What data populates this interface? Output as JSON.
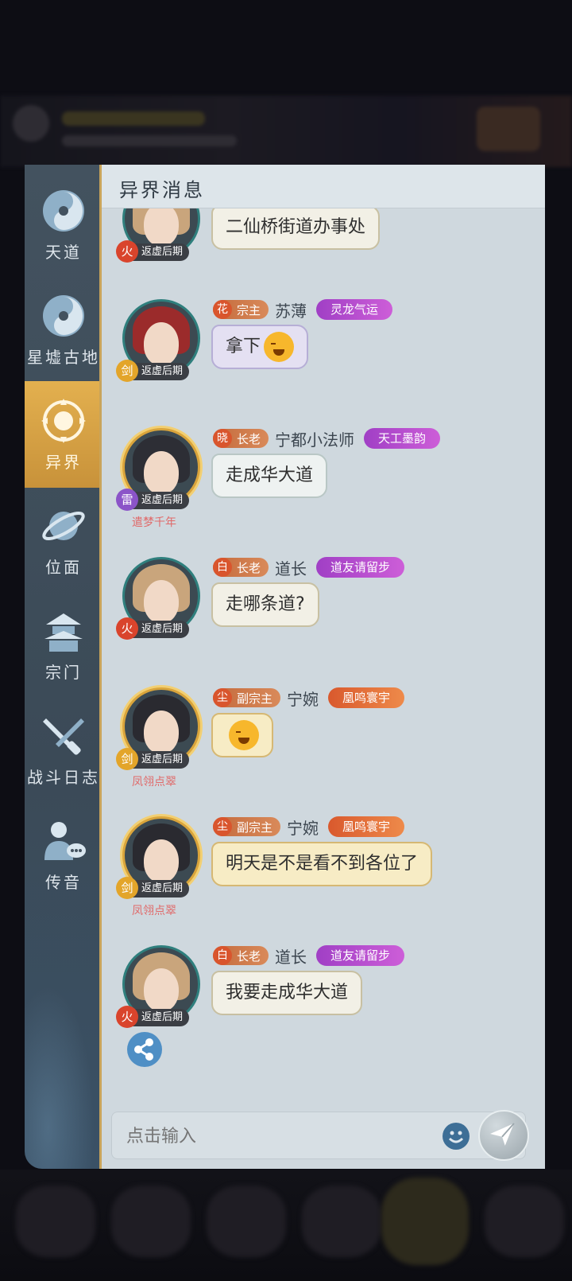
{
  "sidebar": {
    "items": [
      {
        "label": "天道",
        "icon": "taiji-swirl-icon",
        "active": false
      },
      {
        "label": "星墟古地",
        "icon": "taiji-swirl-icon",
        "active": false
      },
      {
        "label": "异界",
        "icon": "lotus-emblem-icon",
        "active": true
      },
      {
        "label": "位面",
        "icon": "planet-icon",
        "active": false
      },
      {
        "label": "宗门",
        "icon": "pagoda-icon",
        "active": false
      },
      {
        "label": "战斗日志",
        "icon": "crossed-swords-icon",
        "active": false
      },
      {
        "label": "传音",
        "icon": "person-chat-icon",
        "active": false
      }
    ]
  },
  "panel": {
    "title": "异界消息"
  },
  "messages": [
    {
      "realm": "返虚后期",
      "element": "火",
      "text": "二仙桥街道办事处"
    },
    {
      "role_icon": "花",
      "role": "宗主",
      "name": "苏薄",
      "honor": "灵龙气运",
      "realm": "返虚后期",
      "element": "剑",
      "text": "拿下"
    },
    {
      "role_icon": "晓",
      "role": "长老",
      "name": "宁都小法师",
      "honor": "天工墨韵",
      "realm": "返虚后期",
      "element": "雷",
      "title": "遣梦千年",
      "text": "走成华大道"
    },
    {
      "role_icon": "白",
      "role": "长老",
      "name": "道长",
      "honor": "道友请留步",
      "realm": "返虚后期",
      "element": "火",
      "text": "走哪条道?"
    },
    {
      "role_icon": "尘",
      "role": "副宗主",
      "name": "宁婉",
      "honor": "凰鸣寰宇",
      "realm": "返虚后期",
      "element": "剑",
      "title": "凤翎点翠",
      "text": ""
    },
    {
      "role_icon": "尘",
      "role": "副宗主",
      "name": "宁婉",
      "honor": "凰鸣寰宇",
      "realm": "返虚后期",
      "element": "剑",
      "title": "凤翎点翠",
      "text": "明天是不是看不到各位了"
    },
    {
      "role_icon": "白",
      "role": "长老",
      "name": "道长",
      "honor": "道友请留步",
      "realm": "返虚后期",
      "element": "火",
      "text": "我要走成华大道"
    }
  ],
  "input": {
    "placeholder": "点击输入"
  },
  "colors": {
    "accent_gold": "#d4a147",
    "panel_bg": "#cfd8de",
    "sidebar_bg": "#43525f"
  }
}
